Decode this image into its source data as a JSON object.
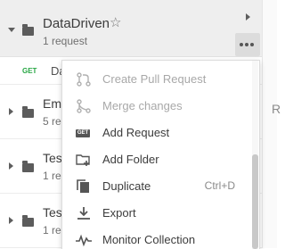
{
  "collection": {
    "name": "DataDriven",
    "count": "1 request"
  },
  "request": {
    "method": "GET",
    "name": "Da"
  },
  "collections": [
    {
      "name": "Emp",
      "count": "5 re"
    },
    {
      "name": "Tes",
      "count": "1 re"
    },
    {
      "name": "Tes",
      "count": "1 re"
    }
  ],
  "right_panel": {
    "letter": "R"
  },
  "menu": {
    "items": [
      {
        "label": "Create Pull Request",
        "disabled": true,
        "icon": "pull-request-icon"
      },
      {
        "label": "Merge changes",
        "disabled": true,
        "icon": "merge-icon"
      },
      {
        "label": "Add Request",
        "disabled": false,
        "icon": "get-request-icon"
      },
      {
        "label": "Add Folder",
        "disabled": false,
        "icon": "add-folder-icon"
      },
      {
        "label": "Duplicate",
        "disabled": false,
        "icon": "duplicate-icon",
        "shortcut": "Ctrl+D"
      },
      {
        "label": "Export",
        "disabled": false,
        "icon": "export-icon"
      },
      {
        "label": "Monitor Collection",
        "disabled": false,
        "icon": "monitor-icon"
      }
    ]
  },
  "colors": {
    "get_method": "#26a643",
    "disabled_text": "#a8a8a8",
    "header_bg": "#eeeeee"
  }
}
